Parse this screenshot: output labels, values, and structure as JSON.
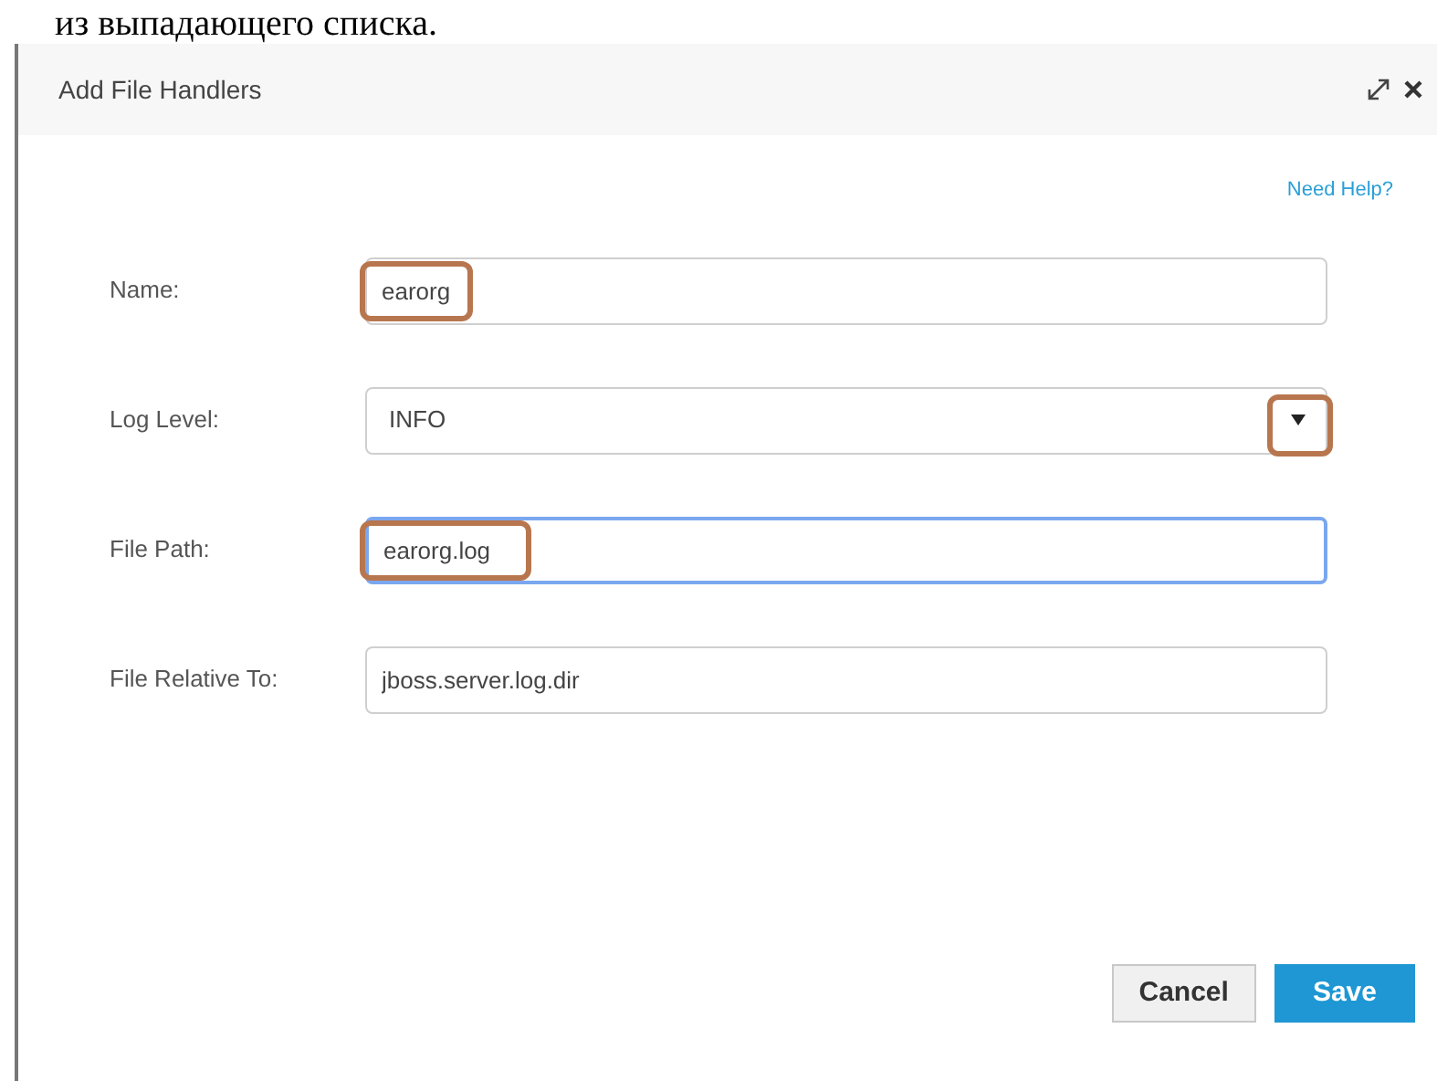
{
  "document_text": "из выпадающего списка.",
  "dialog": {
    "title": "Add File Handlers",
    "help_link": "Need Help?",
    "fields": [
      {
        "kind": "text",
        "label": "Name:",
        "value": "earorg",
        "focused": false,
        "highlighted": true
      },
      {
        "kind": "select",
        "label": "Log Level:",
        "value": "INFO",
        "focused": false,
        "highlighted": true
      },
      {
        "kind": "text",
        "label": "File Path:",
        "value": "earorg.log",
        "focused": true,
        "highlighted": true
      },
      {
        "kind": "text",
        "label": "File Relative To:",
        "value": "jboss.server.log.dir",
        "focused": false,
        "highlighted": false
      }
    ],
    "buttons": [
      {
        "label": "Cancel",
        "kind": "secondary"
      },
      {
        "label": "Save",
        "kind": "primary"
      }
    ]
  }
}
